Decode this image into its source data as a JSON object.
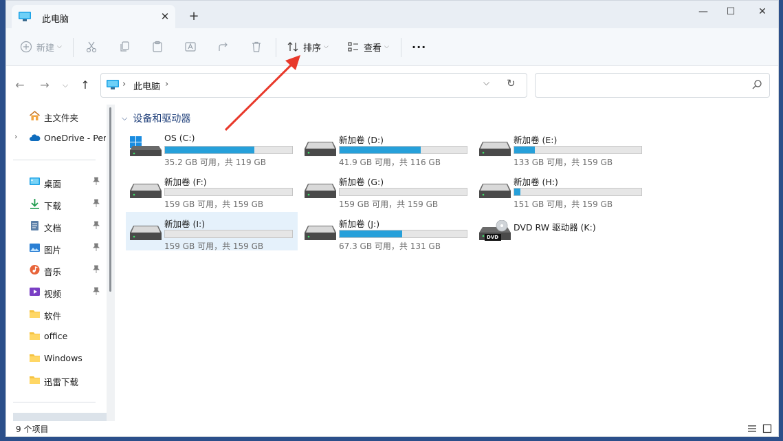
{
  "tab": {
    "title": "此电脑"
  },
  "window_controls": {
    "minimize": "—",
    "maximize": "☐",
    "close": "✕"
  },
  "commands": {
    "new": "新建",
    "sort": "排序",
    "view": "查看",
    "more": "···"
  },
  "address": {
    "location": "此电脑"
  },
  "nav": {
    "items": [
      {
        "label": "主文件夹"
      },
      {
        "label": "OneDrive - Per"
      },
      {
        "label": "桌面"
      },
      {
        "label": "下载"
      },
      {
        "label": "文档"
      },
      {
        "label": "图片"
      },
      {
        "label": "音乐"
      },
      {
        "label": "视频"
      },
      {
        "label": "软件"
      },
      {
        "label": "office"
      },
      {
        "label": "Windows"
      },
      {
        "label": "迅雷下载"
      }
    ]
  },
  "group": {
    "title": "设备和驱动器"
  },
  "drives": [
    {
      "name": "OS (C:)",
      "space": "35.2 GB 可用，共 119 GB",
      "used_fraction": 0.7,
      "bar_color": "#26a0da"
    },
    {
      "name": "新加卷 (D:)",
      "space": "41.9 GB 可用，共 116 GB",
      "used_fraction": 0.64,
      "bar_color": "#26a0da"
    },
    {
      "name": "新加卷 (E:)",
      "space": "133 GB 可用，共 159 GB",
      "used_fraction": 0.16,
      "bar_color": "#26a0da"
    },
    {
      "name": "新加卷 (F:)",
      "space": "159 GB 可用，共 159 GB",
      "used_fraction": 0.0,
      "bar_color": "#26a0da"
    },
    {
      "name": "新加卷 (G:)",
      "space": "159 GB 可用，共 159 GB",
      "used_fraction": 0.0,
      "bar_color": "#26a0da"
    },
    {
      "name": "新加卷 (H:)",
      "space": "151 GB 可用，共 159 GB",
      "used_fraction": 0.05,
      "bar_color": "#26a0da"
    },
    {
      "name": "新加卷 (I:)",
      "space": "159 GB 可用，共 159 GB",
      "used_fraction": 0.0,
      "bar_color": "#26a0da"
    },
    {
      "name": "新加卷 (J:)",
      "space": "67.3 GB 可用，共 131 GB",
      "used_fraction": 0.49,
      "bar_color": "#26a0da"
    },
    {
      "name": "DVD RW 驱动器 (K:)",
      "dvd_label": "DVD"
    }
  ],
  "status": {
    "count": "9 个项目"
  },
  "colors": {
    "accent": "#26a0da",
    "annotation": "#e8392b"
  }
}
